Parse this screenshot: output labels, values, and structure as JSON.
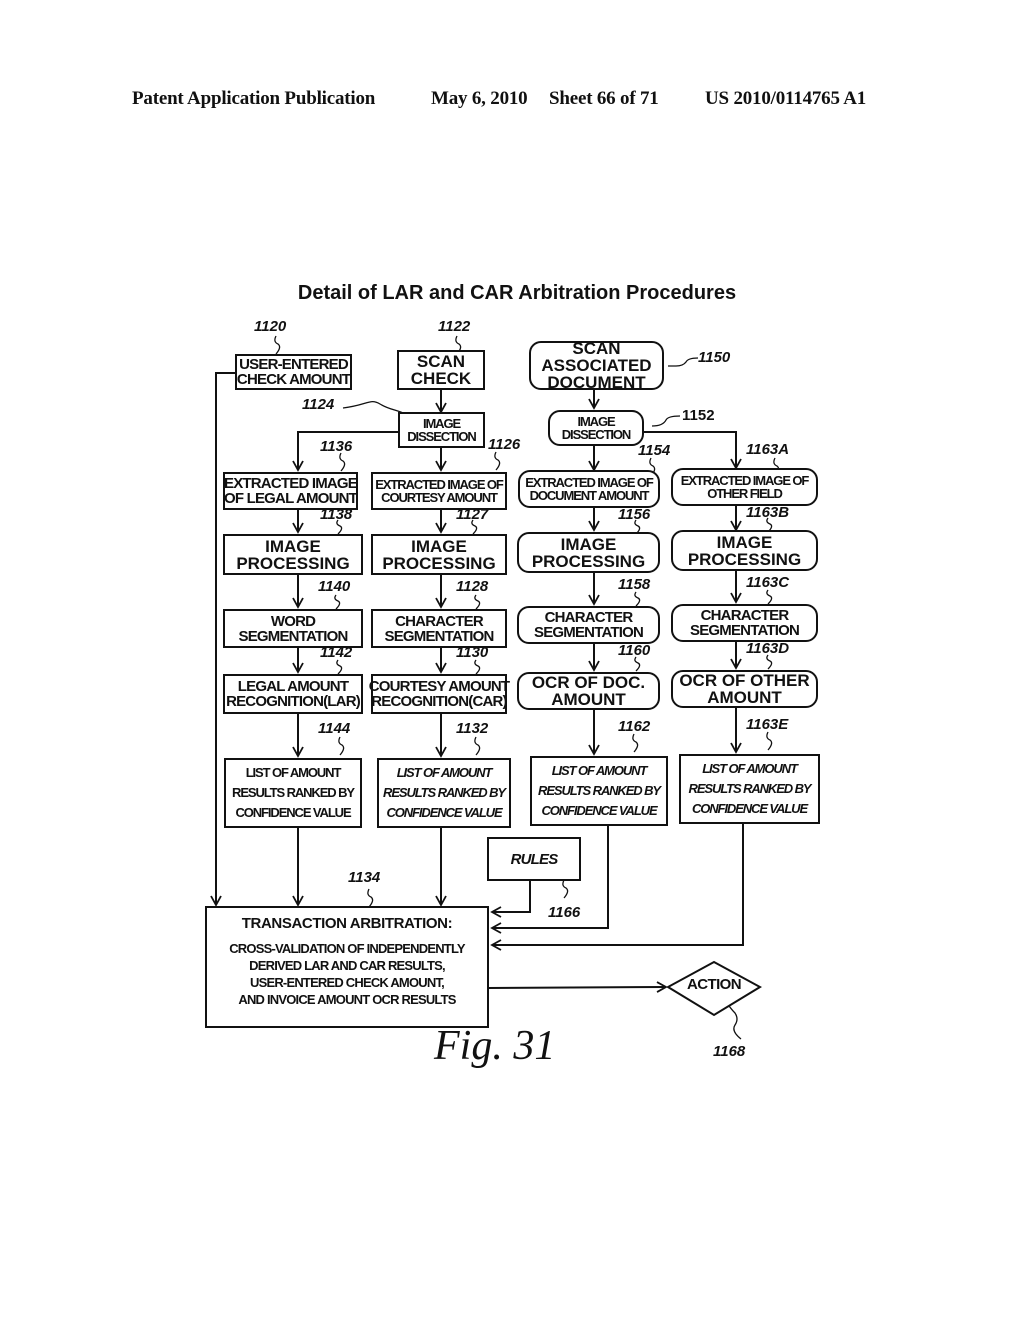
{
  "header": {
    "publication": "Patent Application Publication",
    "date": "May 6, 2010",
    "sheet": "Sheet 66 of 71",
    "patent_number": "US 2010/0114765 A1"
  },
  "diagram": {
    "title": "Detail of LAR and CAR Arbitration Procedures",
    "figure_label": "Fig. 31",
    "nodes": {
      "user_entered": {
        "ref": "1120",
        "lines": [
          "USER-ENTERED",
          "CHECK AMOUNT"
        ]
      },
      "scan_check": {
        "ref": "1122",
        "lines": [
          "SCAN",
          "CHECK"
        ]
      },
      "scan_doc": {
        "ref": "1150",
        "lines": [
          "SCAN",
          "ASSOCIATED",
          "DOCUMENT"
        ]
      },
      "dissect_check": {
        "ref": "1124",
        "lines": [
          "IMAGE",
          "DISSECTION"
        ]
      },
      "dissect_doc": {
        "ref": "1152",
        "lines": [
          "IMAGE",
          "DISSECTION"
        ]
      },
      "extract_legal": {
        "ref": "1136",
        "lines": [
          "EXTRACTED IMAGE",
          "OF LEGAL AMOUNT"
        ]
      },
      "extract_courtesy": {
        "ref": "1126",
        "lines": [
          "EXTRACTED IMAGE OF",
          "COURTESY AMOUNT"
        ]
      },
      "extract_doc": {
        "ref": "1154",
        "lines": [
          "EXTRACTED IMAGE OF",
          "DOCUMENT AMOUNT"
        ]
      },
      "extract_other": {
        "ref": "1163A",
        "lines": [
          "EXTRACTED IMAGE OF",
          "OTHER FIELD"
        ]
      },
      "proc_legal": {
        "ref": "1138",
        "lines": [
          "IMAGE",
          "PROCESSING"
        ]
      },
      "proc_courtesy": {
        "ref": "1127",
        "lines": [
          "IMAGE",
          "PROCESSING"
        ]
      },
      "proc_doc": {
        "ref": "1156",
        "lines": [
          "IMAGE",
          "PROCESSING"
        ]
      },
      "proc_other": {
        "ref": "1163B",
        "lines": [
          "IMAGE",
          "PROCESSING"
        ]
      },
      "seg_legal": {
        "ref": "1140",
        "lines": [
          "WORD",
          "SEGMENTATION"
        ]
      },
      "seg_courtesy": {
        "ref": "1128",
        "lines": [
          "CHARACTER",
          "SEGMENTATION"
        ]
      },
      "seg_doc": {
        "ref": "1158",
        "lines": [
          "CHARACTER",
          "SEGMENTATION"
        ]
      },
      "seg_other": {
        "ref": "1163C",
        "lines": [
          "CHARACTER",
          "SEGMENTATION"
        ]
      },
      "rec_legal": {
        "ref": "1142",
        "lines": [
          "LEGAL AMOUNT",
          "RECOGNITION(LAR)"
        ]
      },
      "rec_courtesy": {
        "ref": "1130",
        "lines": [
          "COURTESY AMOUNT",
          "RECOGNITION(CAR)"
        ]
      },
      "rec_doc": {
        "ref": "1160",
        "lines": [
          "OCR OF DOC.",
          "AMOUNT"
        ]
      },
      "rec_other": {
        "ref": "1163D",
        "lines": [
          "OCR OF OTHER",
          "AMOUNT"
        ]
      },
      "list_legal": {
        "ref": "1144",
        "lines": [
          "LIST OF AMOUNT",
          "RESULTS RANKED BY",
          "CONFIDENCE VALUE"
        ]
      },
      "list_courtesy": {
        "ref": "1132",
        "lines": [
          "LIST OF AMOUNT",
          "RESULTS RANKED BY",
          "CONFIDENCE VALUE"
        ]
      },
      "list_doc": {
        "ref": "1162",
        "lines": [
          "LIST OF AMOUNT",
          "RESULTS RANKED BY",
          "CONFIDENCE VALUE"
        ]
      },
      "list_other": {
        "ref": "1163E",
        "lines": [
          "LIST OF AMOUNT",
          "RESULTS RANKED BY",
          "CONFIDENCE VALUE"
        ]
      },
      "rules": {
        "ref": "1166",
        "lines": [
          "RULES"
        ]
      },
      "arbitration": {
        "ref": "1134",
        "title": "TRANSACTION ARBITRATION:",
        "lines": [
          "CROSS-VALIDATION OF INDEPENDENTLY",
          "DERIVED LAR AND CAR RESULTS,",
          "USER-ENTERED CHECK AMOUNT,",
          "AND INVOICE AMOUNT OCR RESULTS"
        ]
      },
      "action": {
        "ref": "1168",
        "label": "ACTION"
      }
    }
  }
}
